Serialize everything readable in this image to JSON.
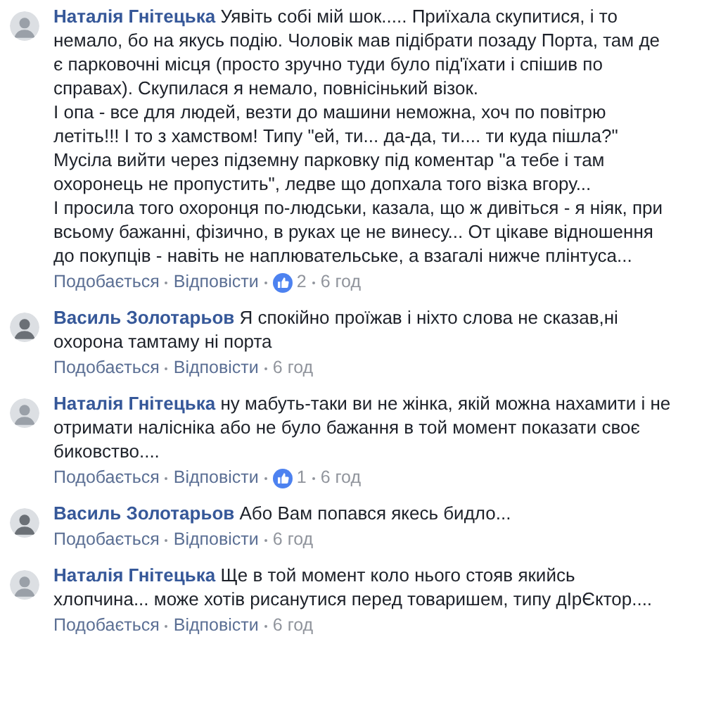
{
  "comments": [
    {
      "author": "Наталія Гнітецька",
      "paragraphs": [
        "Уявіть собі мій шок..... Приїхала скупитися, і то немало, бо на якусь подію. Чоловік мав підібрати позаду Порта, там де є парковочні місця (просто зручно туди було під'їхати і спішив по справах). Скупилася я немало, повнісінький візок.",
        "І опа - все для людей, везти до машини неможна, хоч по повітрю летіть!!! І то з хамством! Типу \"ей, ти... да-да, ти.... ти куда пішла?\"",
        "Мусіла вийти через підземну парковку під коментар \"а тебе і там охоронець не пропустить\", ледве що допхала того візка вгору...",
        "І просила того охоронця по-людськи, казала, що ж дивіться - я ніяк, при всьому бажанні, фізично, в руках це не винесу... От цікаве відношення до покупців - навіть не наплювательське, а взагалі нижче плінтуса..."
      ],
      "like": "Подобається",
      "reply": "Відповісти",
      "reactions": "2",
      "time": "6 год"
    },
    {
      "author": "Василь Золотарьов",
      "paragraphs": [
        "Я спокійно проїжав і ніхто слова не сказав,ні охорона тамтаму ні порта"
      ],
      "like": "Подобається",
      "reply": "Відповісти",
      "time": "6 год"
    },
    {
      "author": "Наталія Гнітецька",
      "paragraphs": [
        "ну мабуть-таки ви не жінка, якій можна нахамити і не отримати налісніка або не було бажання в той момент показати своє биковство...."
      ],
      "like": "Подобається",
      "reply": "Відповісти",
      "reactions": "1",
      "time": "6 год"
    },
    {
      "author": "Василь Золотарьов",
      "paragraphs": [
        "Або Вам попався якесь бидло..."
      ],
      "like": "Подобається",
      "reply": "Відповісти",
      "time": "6 год"
    },
    {
      "author": "Наталія Гнітецька",
      "paragraphs": [
        "Ще в той момент коло нього стояв якийсь хлопчина... може хотів рисанутися перед товаришем, типу дІрЄктор...."
      ],
      "like": "Подобається",
      "reply": "Відповісти",
      "time": "6 год"
    }
  ]
}
